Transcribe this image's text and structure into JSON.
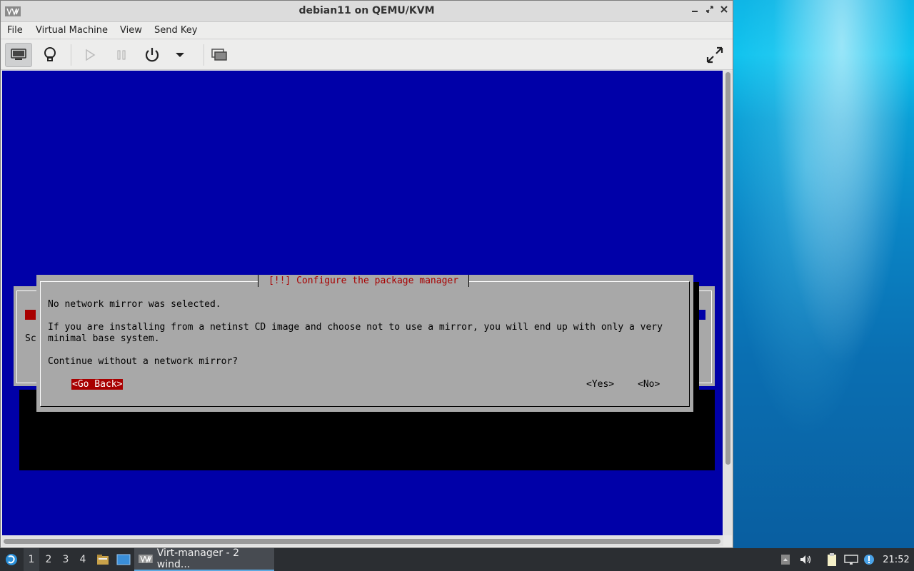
{
  "window": {
    "title": "debian11 on QEMU/KVM",
    "app_icon_text": "VM",
    "controls": {
      "minimize": "–",
      "maximize": "⤢",
      "close": "✕"
    }
  },
  "menubar": {
    "items": [
      "File",
      "Virtual Machine",
      "View",
      "Send Key"
    ]
  },
  "toolbar": {
    "buttons": [
      "console-icon",
      "details-lightbulb-icon",
      "run-play-icon",
      "pause-icon",
      "power-icon",
      "power-dropdown-icon",
      "screenshot-icon",
      "fullscreen-icon"
    ],
    "active": "console-icon"
  },
  "vm_screen": {
    "background_color": "#0000a8",
    "background_dialog_partial_text": "Sc",
    "dialog": {
      "title": "[!!] Configure the package manager",
      "line1": "No network mirror was selected.",
      "line2": "If you are installing from a netinst CD image and choose not to use a mirror, you will end up with only a very",
      "line3": "minimal base system.",
      "question": "Continue without a network mirror?",
      "buttons": {
        "go_back": "<Go Back>",
        "yes": "<Yes>",
        "no": "<No>"
      },
      "focused": "<Go Back>"
    }
  },
  "taskbar": {
    "workspaces": [
      "1",
      "2",
      "3",
      "4"
    ],
    "active_workspace": "1",
    "task_label": "Virt-manager - 2 wind...",
    "tray_icons": [
      "notes-icon",
      "volume-icon",
      "clipboard-icon",
      "network-icon",
      "updates-icon"
    ],
    "clock": "21:52"
  }
}
